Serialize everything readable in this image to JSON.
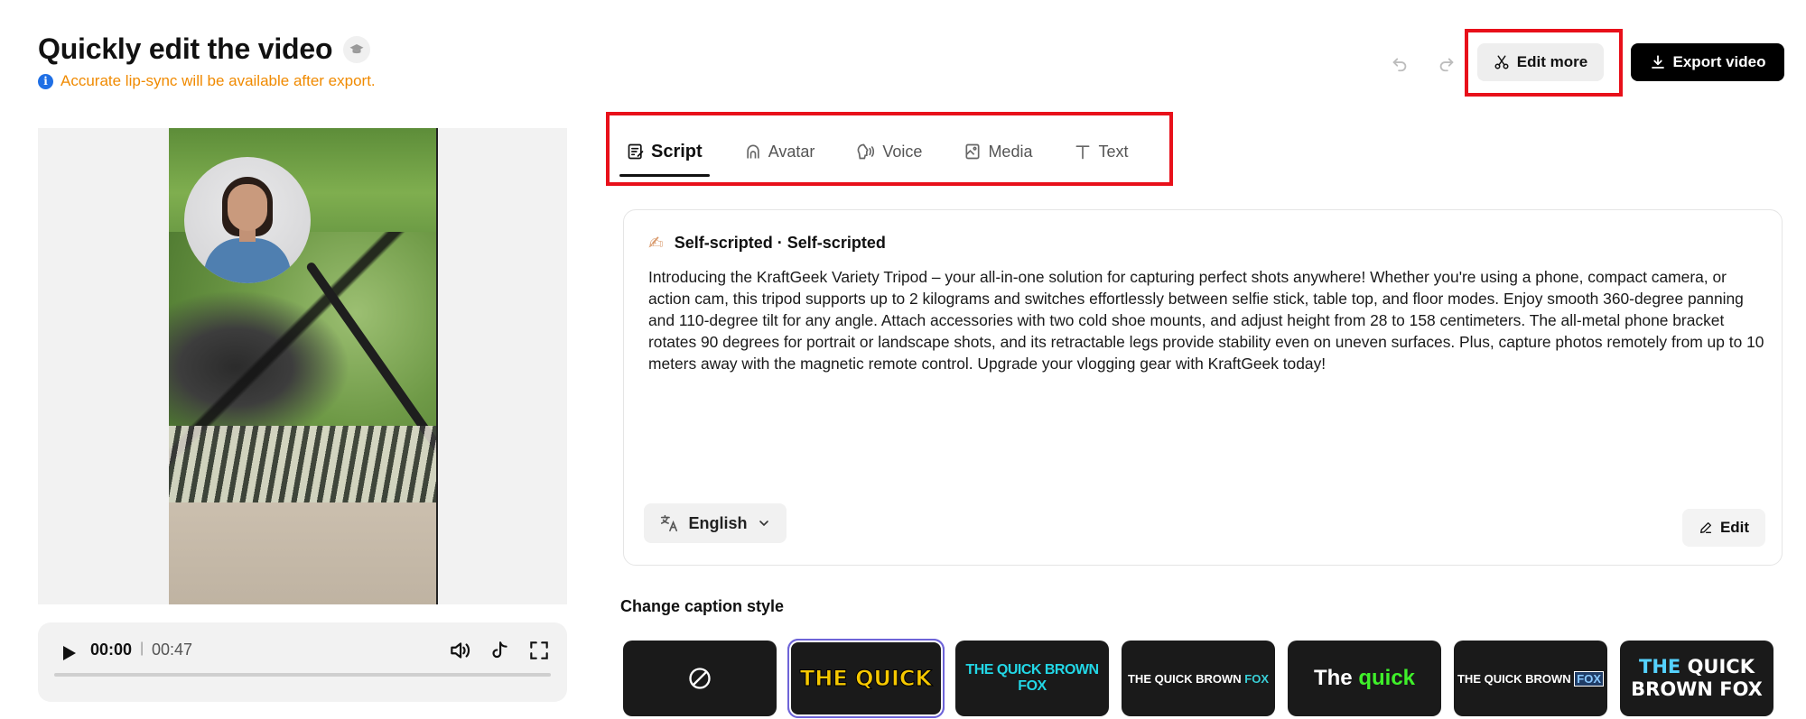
{
  "header": {
    "title": "Quickly edit the video",
    "info_text": "Accurate lip-sync will be available after export.",
    "edit_more_label": "Edit more",
    "export_label": "Export video"
  },
  "player": {
    "current_time": "00:00",
    "separator": "|",
    "total_time": "00:47",
    "progress": 0
  },
  "tabs": [
    {
      "label": "Script",
      "icon": "script-icon",
      "active": true
    },
    {
      "label": "Avatar",
      "icon": "avatar-icon",
      "active": false
    },
    {
      "label": "Voice",
      "icon": "voice-icon",
      "active": false
    },
    {
      "label": "Media",
      "icon": "media-icon",
      "active": false
    },
    {
      "label": "Text",
      "icon": "text-icon",
      "active": false
    }
  ],
  "script": {
    "title": "Self-scripted · Self-scripted",
    "body": "Introducing the KraftGeek Variety Tripod – your all-in-one solution for capturing perfect shots anywhere! Whether you're using a phone, compact camera, or action cam, this tripod supports up to 2 kilograms and switches effortlessly between selfie stick, table top, and floor modes. Enjoy smooth 360-degree panning and 110-degree tilt for any angle. Attach accessories with two cold shoe mounts, and adjust height from 28 to 158 centimeters. The all-metal phone bracket rotates 90 degrees for portrait or landscape shots, and its retractable legs provide stability even on uneven surfaces. Plus, capture photos remotely from up to 10 meters away with the magnetic remote control. Upgrade your vlogging gear with KraftGeek today!",
    "language": "English",
    "edit_label": "Edit"
  },
  "captions": {
    "label": "Change caption style",
    "styles": [
      {
        "name": "none",
        "text": ""
      },
      {
        "name": "style-1",
        "text": "THE QUICK"
      },
      {
        "name": "style-2",
        "text": "THE QUICK BROWN FOX"
      },
      {
        "name": "style-3",
        "text_a": "THE QUICK BROWN ",
        "text_b": "FOX"
      },
      {
        "name": "style-4",
        "text_a": "The ",
        "text_b": "quick"
      },
      {
        "name": "style-5",
        "text_a": "THE QUICK BROWN ",
        "text_b": "FOX"
      },
      {
        "name": "style-6",
        "text_a": "THE",
        "text_b": " QUICK",
        "text_c": "BROWN FOX"
      }
    ],
    "selected_index": 1
  },
  "colors": {
    "accent_red_frame": "#e8101a",
    "info_orange": "#f08a00",
    "info_blue": "#1f6fe5",
    "selected_outline": "#6e64d8"
  }
}
